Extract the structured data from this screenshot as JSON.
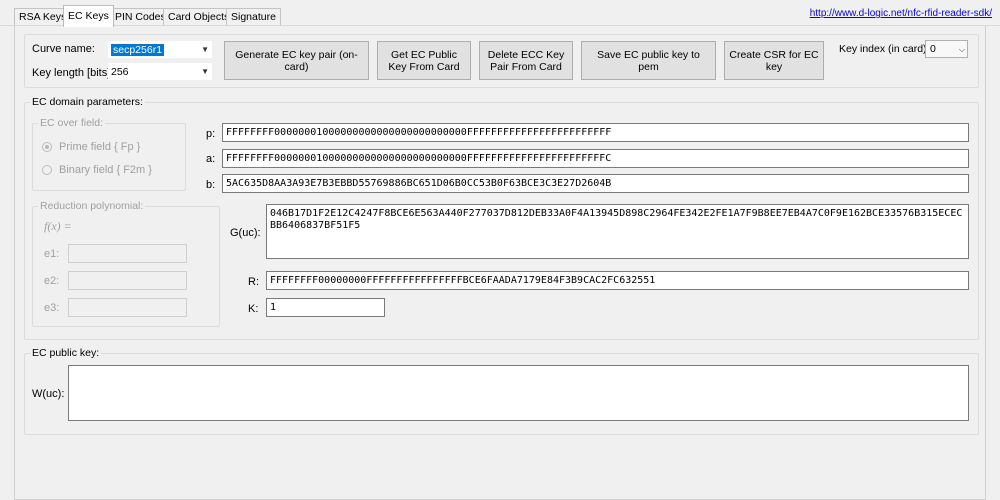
{
  "tabs": [
    "RSA Keys",
    "EC Keys",
    "PIN Codes",
    "Card Objects",
    "Signature"
  ],
  "sdk_link": "http://www.d-logic.net/nfc-rfid-reader-sdk/",
  "curve": {
    "name_label": "Curve name:",
    "name_value": "secp256r1",
    "length_label": "Key length [bits]:",
    "length_value": "256"
  },
  "buttons": {
    "generate": "Generate EC key pair (on-card)",
    "get_public": "Get EC Public Key From Card",
    "delete_pair": "Delete ECC Key Pair From Card",
    "save_pem": "Save EC public key to pem",
    "create_csr": "Create CSR for EC key"
  },
  "key_index": {
    "label": "Key index (in card):",
    "value": "0"
  },
  "domain": {
    "title": "EC domain parameters:",
    "field_group": "EC over field:",
    "prime": "Prime field { Fp }",
    "binary": "Binary field { F2m }",
    "poly_group": "Reduction polynomial:",
    "fx": "f(x) =",
    "e1": "e1:",
    "e2": "e2:",
    "e3": "e3:",
    "p_label": "p:",
    "p": "FFFFFFFF00000001000000000000000000000000FFFFFFFFFFFFFFFFFFFFFFFF",
    "a_label": "a:",
    "a": "FFFFFFFF00000001000000000000000000000000FFFFFFFFFFFFFFFFFFFFFFFC",
    "b_label": "b:",
    "b": "5AC635D8AA3A93E7B3EBBD55769886BC651D06B0CC53B0F63BCE3C3E27D2604B",
    "g_label": "G(uc):",
    "g": "046B17D1F2E12C4247F8BCE6E563A440F277037D812DEB33A0F4A13945D898C2964FE342E2FE1A7F9B8EE7EB4A7C0F9E162BCE33576B315ECECBB6406837BF51F5",
    "r_label": "R:",
    "r": "FFFFFFFF00000000FFFFFFFFFFFFFFFFBCE6FAADA7179E84F3B9CAC2FC632551",
    "k_label": "K:",
    "k": "1"
  },
  "public_key": {
    "title": "EC public key:",
    "w_label": "W(uc):",
    "w": ""
  }
}
